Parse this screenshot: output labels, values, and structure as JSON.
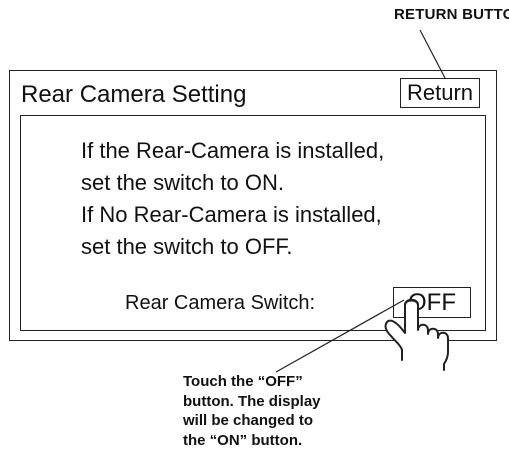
{
  "callouts": {
    "return_button": "RETURN BUTTON",
    "touch_instruction": [
      "Touch the “OFF”",
      "button.  The display",
      "will be changed to",
      "the “ON” button."
    ]
  },
  "screen": {
    "title": "Rear Camera Setting",
    "return_label": "Return",
    "instructions": [
      "If the Rear-Camera is installed,",
      "set the switch to ON.",
      "If No Rear-Camera is installed,",
      "set the switch to OFF."
    ],
    "switch_label": "Rear Camera Switch:",
    "switch_value": "OFF"
  },
  "icons": [
    "pointing-hand-icon"
  ]
}
